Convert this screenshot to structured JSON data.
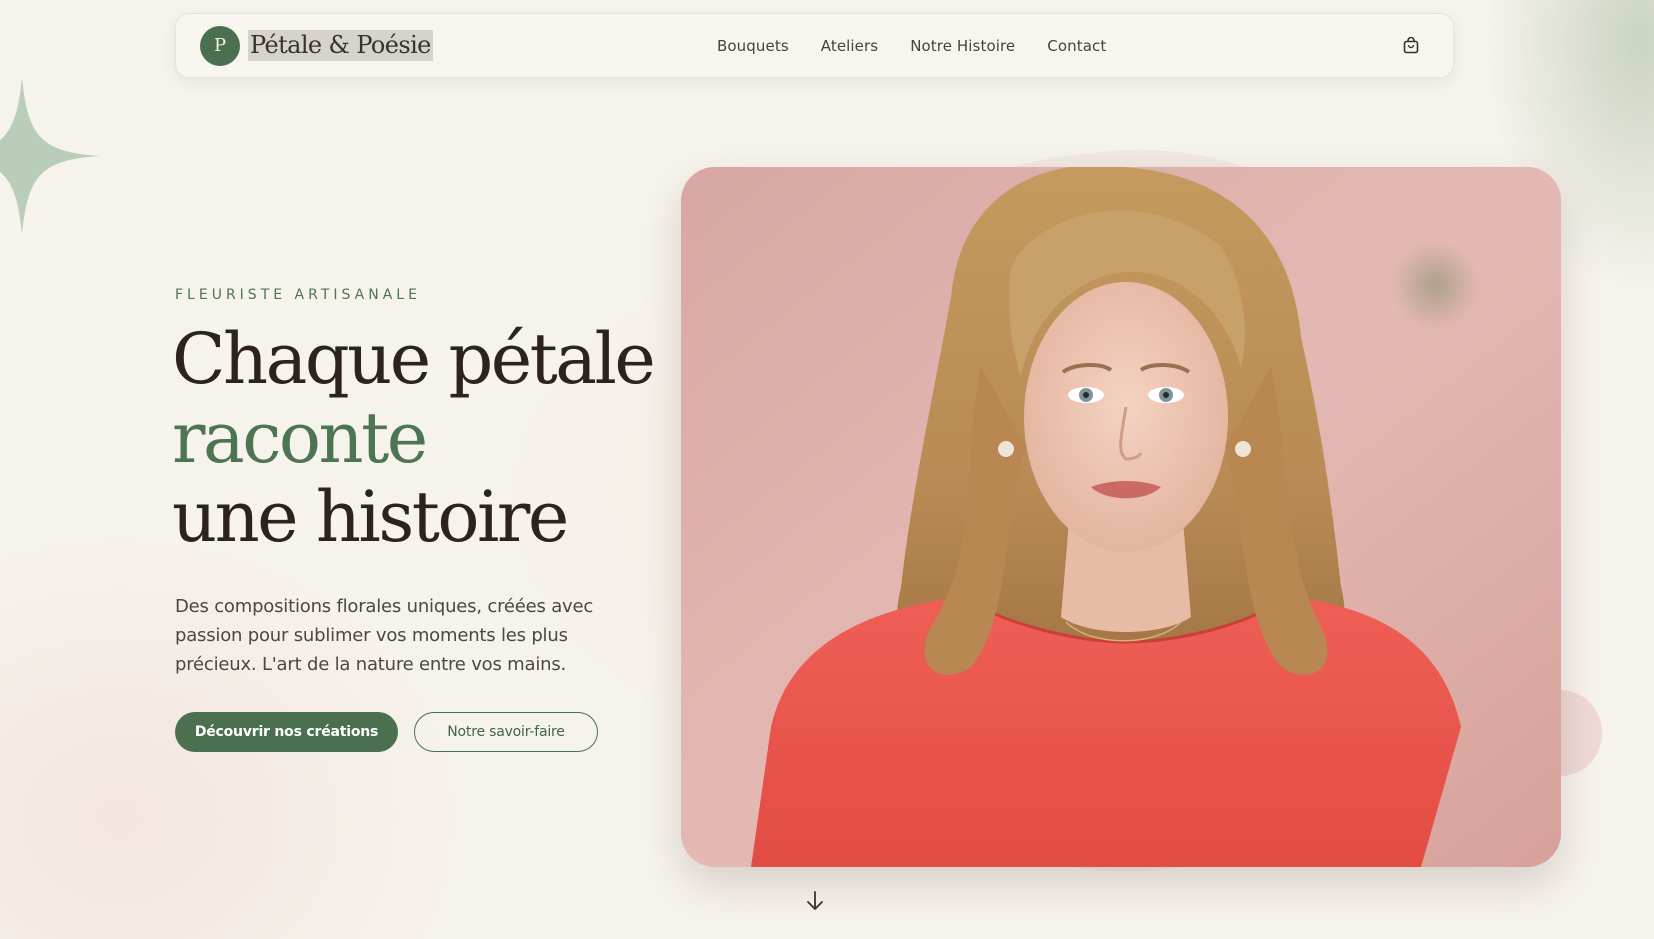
{
  "brand": {
    "logo_letter": "P",
    "name": "Pétale & Poésie",
    "accent_color": "#4a7050"
  },
  "nav": {
    "links": [
      "Bouquets",
      "Ateliers",
      "Notre Histoire",
      "Contact"
    ],
    "cart_icon": "shopping-bag-icon"
  },
  "hero": {
    "eyebrow": "FLEURISTE ARTISANALE",
    "headline_line1": "Chaque pétale",
    "headline_line2": "raconte",
    "headline_line3": "une histoire",
    "description": "Des compositions florales uniques, créées avec passion pour sublimer vos moments les plus précieux. L'art de la nature entre vos mains.",
    "primary_button": "Découvrir nos créations",
    "secondary_button": "Notre savoir-faire",
    "image_icon": "portrait-photo",
    "scroll_icon": "arrow-down-icon"
  }
}
